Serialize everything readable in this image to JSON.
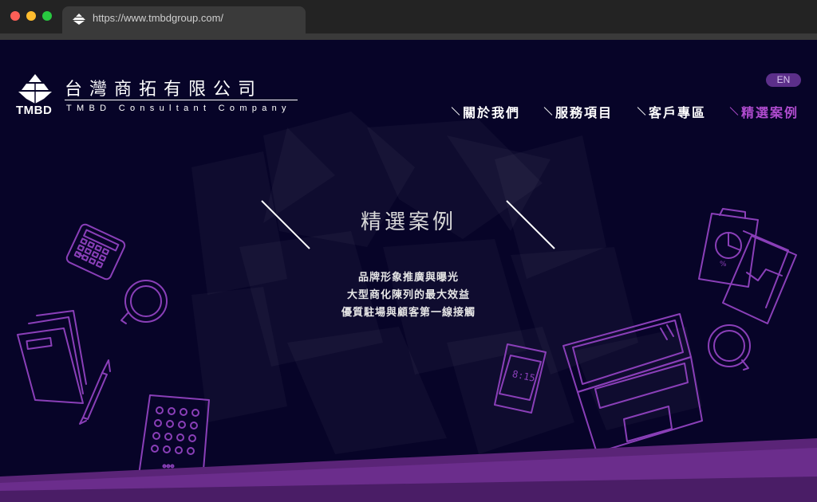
{
  "browser": {
    "url": "https://www.tmbdgroup.com/"
  },
  "logo": {
    "brand": "TMBD",
    "name_zh": "台灣商拓有限公司",
    "name_en": "TMBD Consultant Company"
  },
  "lang_toggle": "EN",
  "nav": [
    {
      "label": "關於我們",
      "active": false
    },
    {
      "label": "服務項目",
      "active": false
    },
    {
      "label": "客戶專區",
      "active": false
    },
    {
      "label": "精選案例",
      "active": true
    }
  ],
  "hero": {
    "title": "精選案例",
    "lines": [
      "品牌形象推廣與曝光",
      "大型商化陳列的最大效益",
      "優質駐場與顧客第一線接觸"
    ]
  },
  "illustration": {
    "phone_time": "8:15",
    "chart_label": "%"
  },
  "colors": {
    "background": "#070428",
    "accent": "#b04ccf",
    "line_art": "#8a3fb8",
    "bottom_band": "#6b2d8c"
  }
}
